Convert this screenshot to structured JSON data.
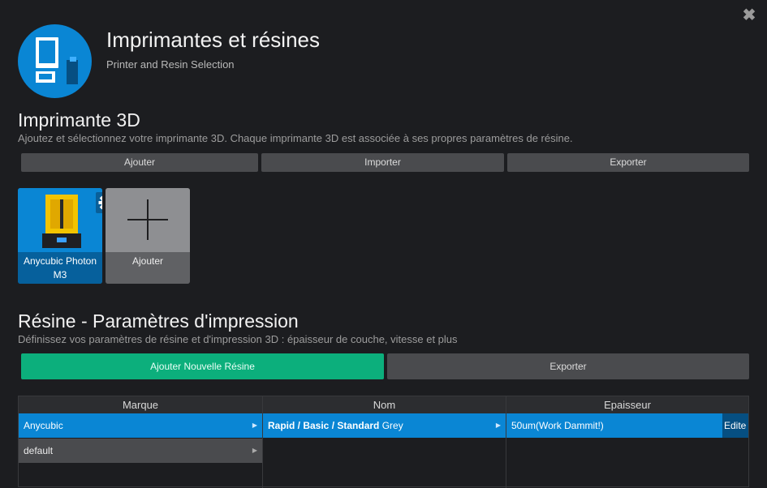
{
  "window": {
    "close_glyph": "✖"
  },
  "header": {
    "title": "Imprimantes et résines",
    "subtitle": "Printer and Resin Selection"
  },
  "printer_section": {
    "heading": "Imprimante 3D",
    "description": "Ajoutez et sélectionnez votre imprimante 3D. Chaque imprimante 3D est associée à ses propres paramètres de résine.",
    "buttons": {
      "add": "Ajouter",
      "import": "Importer",
      "export": "Exporter"
    },
    "cards": [
      {
        "label": "Anycubic Photon M3",
        "icon": "printer-image"
      },
      {
        "label": "Ajouter",
        "icon": "plus-icon"
      }
    ]
  },
  "resin_section": {
    "heading": "Résine - Paramètres d'impression",
    "description": "Définissez vos paramètres de résine et d'impression 3D : épaisseur de couche, vitesse et plus",
    "buttons": {
      "add_new": "Ajouter Nouvelle Résine",
      "export": "Exporter"
    },
    "table": {
      "columns": [
        "Marque",
        "Nom",
        "Epaisseur"
      ],
      "brands": [
        "Anycubic",
        "default"
      ],
      "names": [
        {
          "bold": "Rapid / Basic / Standard",
          "rest": " Grey"
        }
      ],
      "thicknesses": [
        "50um(Work Dammit!)"
      ],
      "edit_label": "Edite"
    }
  },
  "colors": {
    "accent": "#0a86d4",
    "green": "#0caf7c",
    "background": "#1c1d20"
  }
}
